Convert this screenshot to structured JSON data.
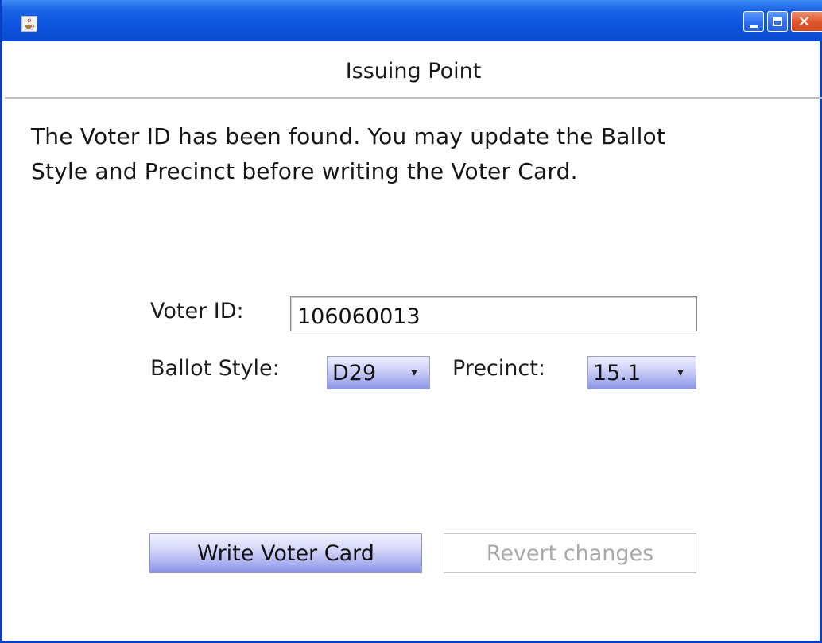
{
  "window": {
    "icon": "java-cup-icon",
    "controls": {
      "minimize": "minimize-icon",
      "maximize": "maximize-icon",
      "close": "close-icon"
    }
  },
  "header": {
    "title": "Issuing Point"
  },
  "message": {
    "line1": "The Voter ID has been found. You may update the Ballot",
    "line2": "Style and Precinct before writing the Voter Card."
  },
  "form": {
    "voter_id_label": "Voter ID:",
    "voter_id_value": "106060013",
    "ballot_style_label": "Ballot Style:",
    "ballot_style_value": "D29",
    "precinct_label": "Precinct:",
    "precinct_value": "15.1"
  },
  "actions": {
    "write_label": "Write Voter Card",
    "revert_label": "Revert changes"
  },
  "colors": {
    "titlebar": "#0d55df",
    "button_gradient_bottom": "#8d94ea",
    "disabled_text": "#a9a9a9"
  }
}
